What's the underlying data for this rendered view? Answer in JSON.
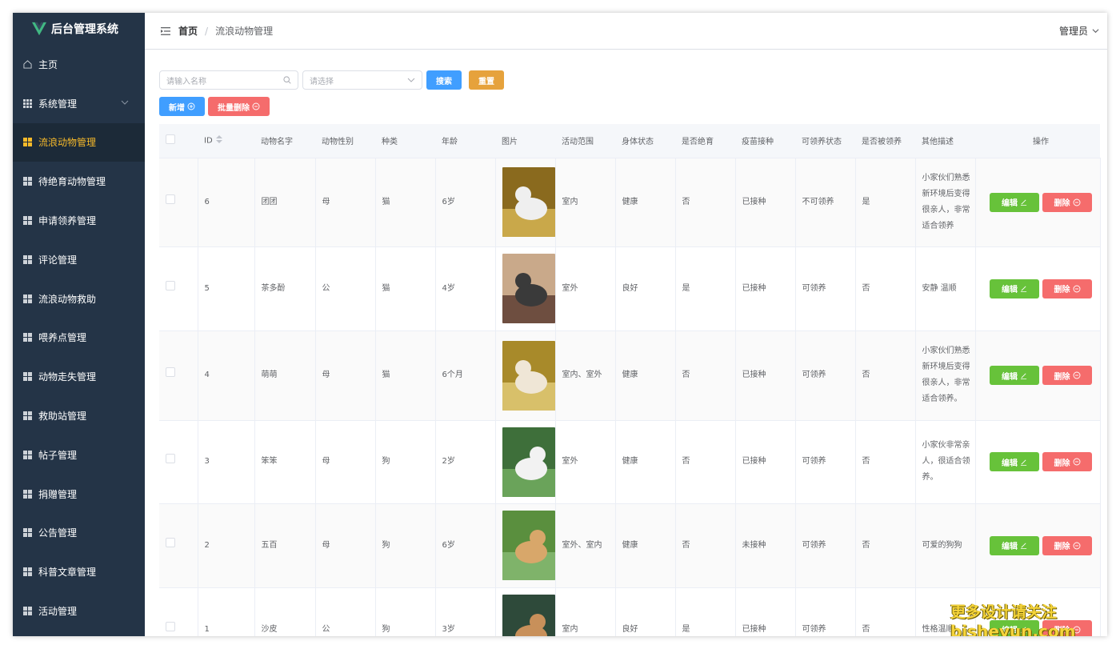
{
  "sidebar": {
    "title": "后台管理系统",
    "items": [
      {
        "label": "主页",
        "icon": "home-icon"
      },
      {
        "label": "系统管理",
        "icon": "grid9-icon",
        "has_children": true
      },
      {
        "label": "流浪动物管理",
        "icon": "grid-icon",
        "active": true
      },
      {
        "label": "待绝育动物管理",
        "icon": "grid-icon"
      },
      {
        "label": "申请领养管理",
        "icon": "grid-icon"
      },
      {
        "label": "评论管理",
        "icon": "grid-icon"
      },
      {
        "label": "流浪动物救助",
        "icon": "grid-icon"
      },
      {
        "label": "喂养点管理",
        "icon": "grid-icon"
      },
      {
        "label": "动物走失管理",
        "icon": "grid-icon"
      },
      {
        "label": "救助站管理",
        "icon": "grid-icon"
      },
      {
        "label": "帖子管理",
        "icon": "grid-icon"
      },
      {
        "label": "捐赠管理",
        "icon": "grid-icon"
      },
      {
        "label": "公告管理",
        "icon": "grid-icon"
      },
      {
        "label": "科普文章管理",
        "icon": "grid-icon"
      },
      {
        "label": "活动管理",
        "icon": "grid-icon"
      }
    ]
  },
  "header": {
    "breadcrumb_home": "首页",
    "breadcrumb_sep": "/",
    "breadcrumb_current": "流浪动物管理",
    "user": "管理员"
  },
  "toolbar": {
    "search_placeholder": "请输入名称",
    "select_placeholder": "请选择",
    "search_label": "搜索",
    "reset_label": "重置",
    "add_label": "新增",
    "batch_delete_label": "批量删除"
  },
  "table": {
    "columns": [
      "ID",
      "动物名字",
      "动物性别",
      "种类",
      "年龄",
      "图片",
      "活动范围",
      "身体状态",
      "是否绝育",
      "疫苗接种",
      "可领养状态",
      "是否被领养",
      "其他描述",
      "操作"
    ],
    "edit_label": "编辑",
    "delete_label": "删除",
    "rows": [
      {
        "id": "6",
        "name": "团团",
        "gender": "母",
        "kind": "猫",
        "age": "6岁",
        "range": "室内",
        "health": "健康",
        "neutered": "否",
        "vaccine": "已接种",
        "adoptable": "不可领养",
        "adopted": "是",
        "desc": "小家伙们熟悉新环境后变得很亲人，非常适合领养"
      },
      {
        "id": "5",
        "name": "茶多酚",
        "gender": "公",
        "kind": "猫",
        "age": "4岁",
        "range": "室外",
        "health": "良好",
        "neutered": "是",
        "vaccine": "已接种",
        "adoptable": "可领养",
        "adopted": "否",
        "desc": "安静 温顺"
      },
      {
        "id": "4",
        "name": "萌萌",
        "gender": "母",
        "kind": "猫",
        "age": "6个月",
        "range": "室内、室外",
        "health": "健康",
        "neutered": "否",
        "vaccine": "已接种",
        "adoptable": "可领养",
        "adopted": "否",
        "desc": "小家伙们熟悉新环境后变得很亲人，非常适合领养。"
      },
      {
        "id": "3",
        "name": "笨笨",
        "gender": "母",
        "kind": "狗",
        "age": "2岁",
        "range": "室外",
        "health": "健康",
        "neutered": "否",
        "vaccine": "已接种",
        "adoptable": "可领养",
        "adopted": "否",
        "desc": "小家伙非常亲人，很适合领养。"
      },
      {
        "id": "2",
        "name": "五百",
        "gender": "母",
        "kind": "狗",
        "age": "6岁",
        "range": "室外、室内",
        "health": "健康",
        "neutered": "否",
        "vaccine": "未接种",
        "adoptable": "可领养",
        "adopted": "否",
        "desc": "可爱的狗狗"
      },
      {
        "id": "1",
        "name": "沙皮",
        "gender": "公",
        "kind": "狗",
        "age": "3岁",
        "range": "室内",
        "health": "良好",
        "neutered": "是",
        "vaccine": "已接种",
        "adoptable": "可领养",
        "adopted": "否",
        "desc": "性格温顺"
      }
    ]
  },
  "watermark": {
    "line1": "更多设计请关注",
    "line2": "bisheyun.com"
  }
}
